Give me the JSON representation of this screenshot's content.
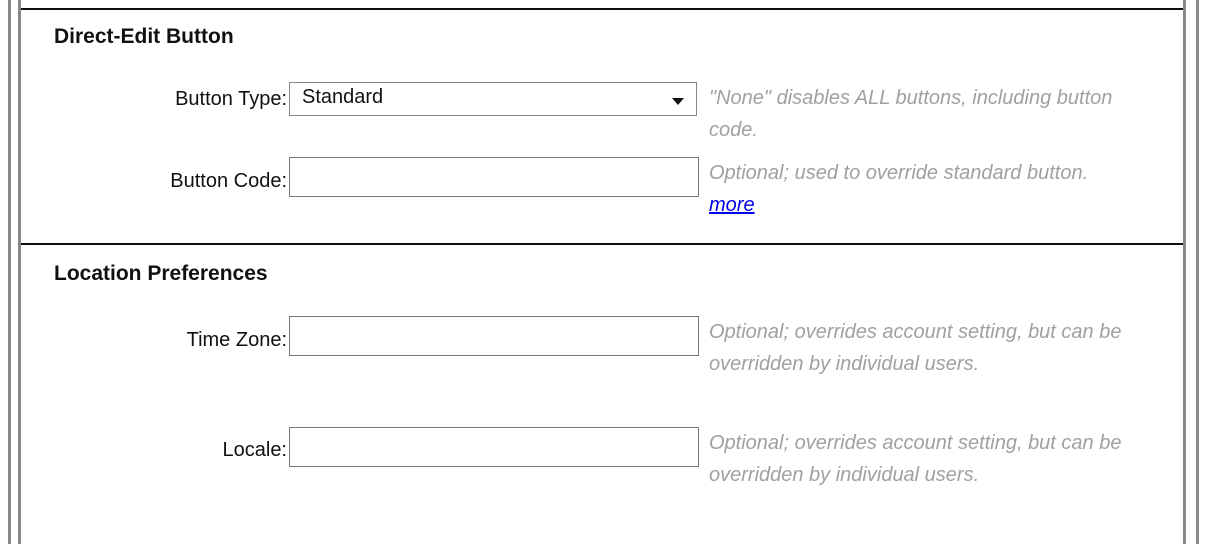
{
  "sections": {
    "direct_edit": {
      "title": "Direct-Edit Button",
      "button_type": {
        "label": "Button Type:",
        "value": "Standard",
        "hint": "\"None\" disables ALL buttons, including button code."
      },
      "button_code": {
        "label": "Button Code:",
        "value": "",
        "hint_text": "Optional; used to override standard button.",
        "hint_link": "more"
      }
    },
    "location": {
      "title": "Location Preferences",
      "time_zone": {
        "label": "Time Zone:",
        "value": "",
        "hint": "Optional; overrides account setting, but can be overridden by individual users."
      },
      "locale": {
        "label": "Locale:",
        "value": "",
        "hint": "Optional; overrides account setting, but can be overridden by individual users."
      }
    }
  },
  "colors": {
    "hint": "#a0a0a0",
    "link": "#0000ee",
    "divider": "#111111",
    "frame": "#888888"
  }
}
